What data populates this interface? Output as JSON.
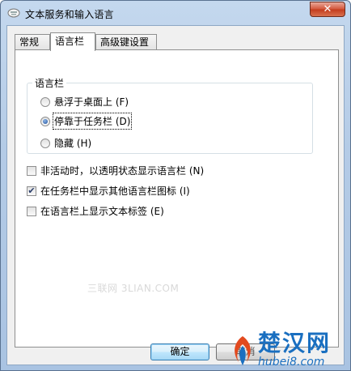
{
  "window": {
    "title": "文本服务和输入语言",
    "close_symbol": "✕",
    "icon": "keyboard-app-icon"
  },
  "tabs": [
    {
      "label": "常规",
      "active": false
    },
    {
      "label": "语言栏",
      "active": true
    },
    {
      "label": "高级键设置",
      "active": false
    }
  ],
  "language_bar_group": {
    "legend": "语言栏",
    "options": [
      {
        "label": "悬浮于桌面上 (F)",
        "selected": false
      },
      {
        "label": "停靠于任务栏 (D)",
        "selected": true
      },
      {
        "label": "隐藏 (H)",
        "selected": false
      }
    ]
  },
  "checkboxes": [
    {
      "label": "非活动时，以透明状态显示语言栏 (N)",
      "checked": false
    },
    {
      "label": "在任务栏中显示其他语言栏图标 (I)",
      "checked": true
    },
    {
      "label": "在语言栏上显示文本标签 (E)",
      "checked": false
    }
  ],
  "watermark": "三联网 3LIAN.COM",
  "buttons": {
    "ok": "确定",
    "cancel": "取消"
  },
  "logo": {
    "text": "楚汉网",
    "sub": "hubei8.com"
  },
  "colors": {
    "titlebar": "#b4cbe6",
    "close_button": "#c33c1d",
    "ok_button_border": "#3c7fb1",
    "logo": "#1a6fc0"
  }
}
